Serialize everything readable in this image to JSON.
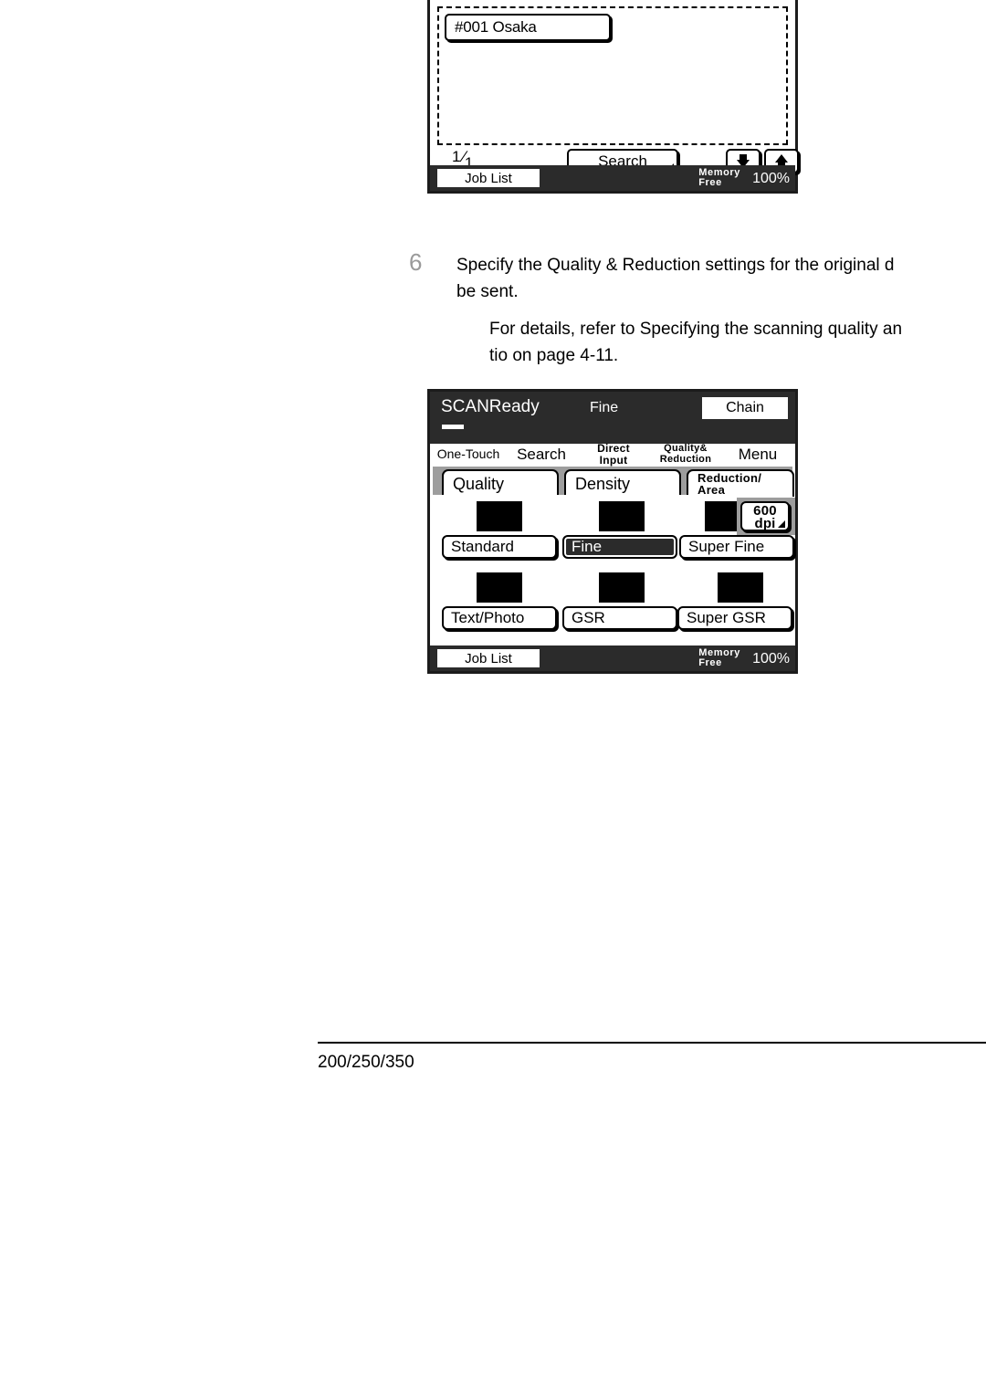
{
  "document": {
    "footer_rule": true,
    "footer_text": "200/250/350"
  },
  "step": {
    "number": "6",
    "body": "Specify the Quality & Reduction settings for the original d",
    "note": "For details, refer to  Specifying the scanning quality an\ntio  on page 4-11."
  },
  "panel_top": {
    "recipient": {
      "chip_label": "#001 Osaka"
    },
    "controls": {
      "page_current": "1",
      "page_total": "1",
      "search_label": "Search",
      "arrow_down": "down-arrow-icon",
      "arrow_up": "up-arrow-icon"
    },
    "statusbar": {
      "job_list": "Job List",
      "memory_label_line1": "Memory",
      "memory_label_line2": "Free",
      "memory_value": "100%"
    }
  },
  "panel_main": {
    "header": {
      "title": "SCANReady",
      "mode": "Fine",
      "chain_label": "Chain"
    },
    "top_tabs": [
      {
        "label": "One-Touch",
        "selected": false
      },
      {
        "label": "Search",
        "selected": false
      },
      {
        "label": "Direct\nInput",
        "selected": false
      },
      {
        "label": "Quality&\nReduction",
        "selected": true
      },
      {
        "label": "Menu",
        "selected": false
      }
    ],
    "sub_tabs": [
      {
        "label": "Quality",
        "selected": true
      },
      {
        "label": "Density",
        "selected": false
      },
      {
        "label": "Reduction/\nArea",
        "selected": false
      }
    ],
    "quality_options": [
      {
        "label": "Standard",
        "selected": false
      },
      {
        "label": "Fine",
        "selected": true
      },
      {
        "label": "Super Fine",
        "selected": false
      },
      {
        "label": "Text/Photo",
        "selected": false
      },
      {
        "label": "GSR",
        "selected": false
      },
      {
        "label": "Super GSR",
        "selected": false
      }
    ],
    "dpi_chip": {
      "line1": "600",
      "line2": "dpi"
    },
    "statusbar": {
      "job_list": "Job List",
      "memory_label_line1": "Memory",
      "memory_label_line2": "Free",
      "memory_value": "100%"
    }
  },
  "colors": {
    "panel_border": "#1c1c1c",
    "statusbar_bg": "#2b2b2b",
    "subtab_bar_bg": "#9d9d9d",
    "step_number": "#9a9a9a",
    "selected_fg": "#ffffff"
  }
}
